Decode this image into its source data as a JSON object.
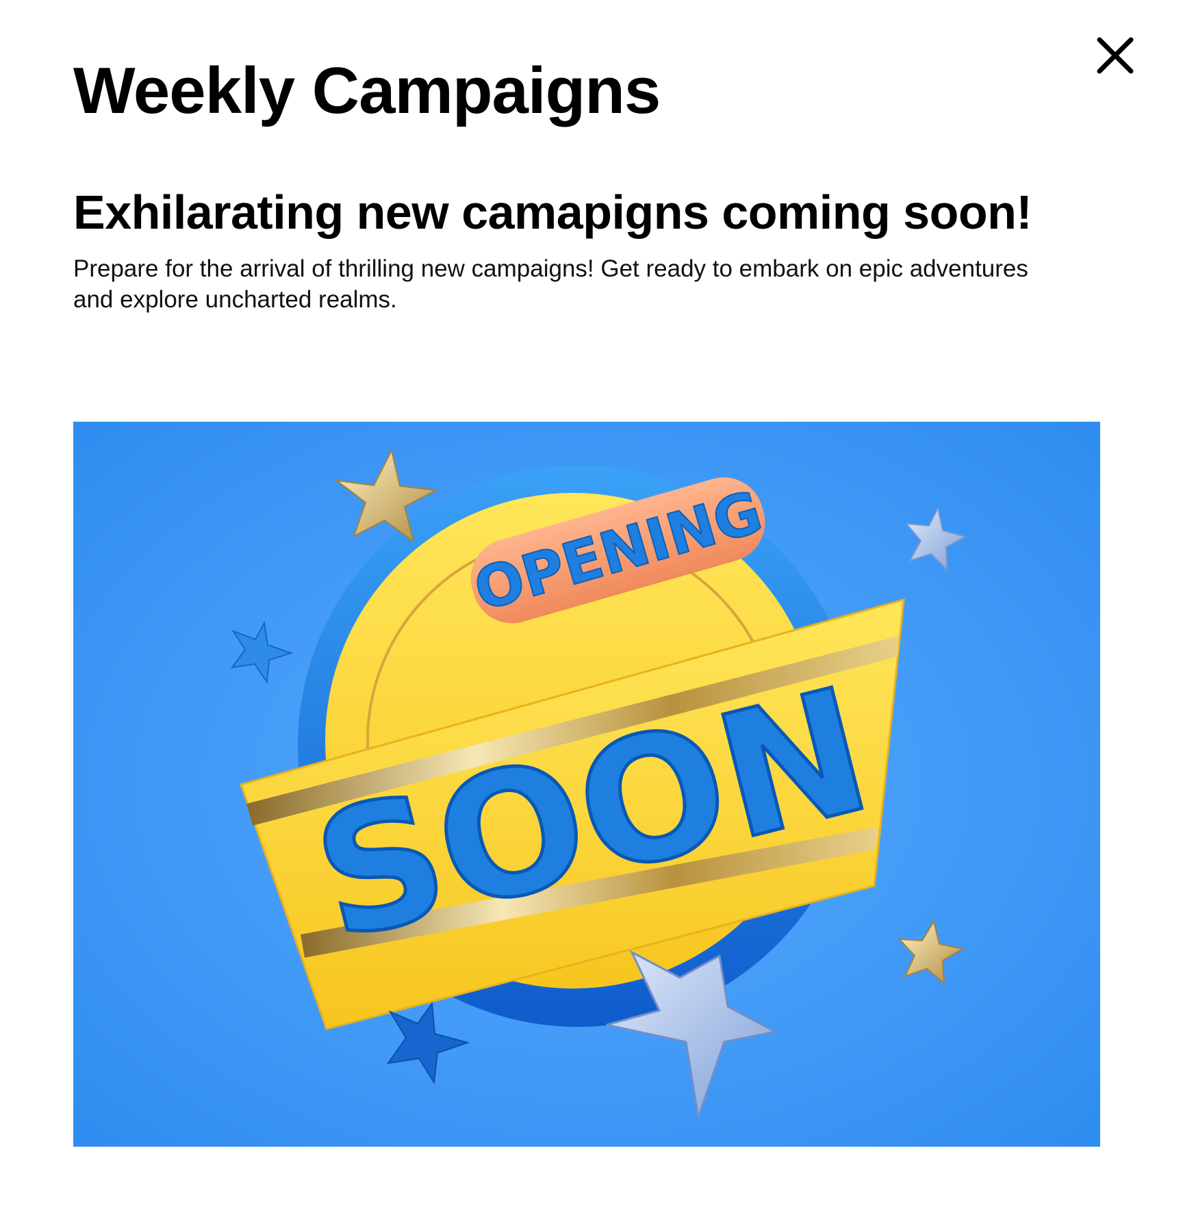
{
  "modal": {
    "title": "Weekly Campaigns",
    "close_icon": "close-icon"
  },
  "content": {
    "headline": "Exhilarating new camapigns coming soon!",
    "description": "Prepare for the arrival of thrilling new campaigns! Get ready to embark on epic adventures and explore uncharted realms."
  },
  "banner": {
    "opening_label": "OPENING",
    "soon_label": "SOON",
    "colors": {
      "background": "#3a94f5",
      "badge_yellow": "#fdd835",
      "ring_blue": "#1a6fd6",
      "pill_orange": "#f4a07a",
      "text_blue": "#1e7fe0",
      "gold": "#c9a24a",
      "silver_blue": "#a9c3ee"
    }
  }
}
